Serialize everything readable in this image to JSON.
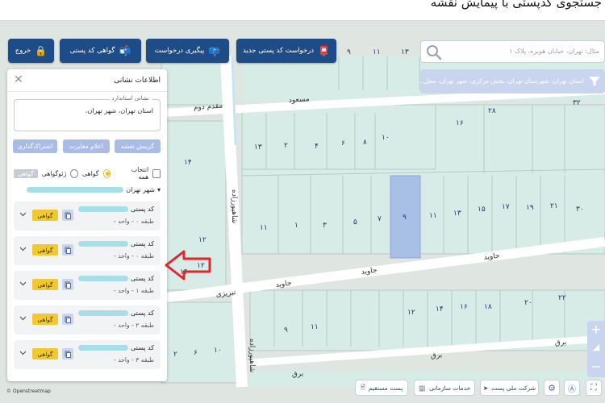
{
  "title": "جستجوی کدپستی با پیمایش نقشه",
  "toolbar": {
    "exit": "خروج",
    "certificate": "گواهی کد پستی",
    "track": "پیگیری درخواست",
    "new_request": "درخواست کد پستی جدید"
  },
  "search": {
    "placeholder": "مثال: تهران، خیابان هویزه، پلاک ۱"
  },
  "filter": {
    "text": "استان تهران، شهرستان تهران، بخش مرکزی، شهر تهران، محل..."
  },
  "panel": {
    "title": "اطلاعات نشانی",
    "address_legend": "نشانی استاندارد",
    "address_value": "استان تهران، شهر تهران،",
    "buttons": {
      "map_pin": "گزینش نقشه",
      "report": "اعلام مغایرت",
      "share": "اشتراک‌گذاری"
    },
    "select_all": "انتخاب همه",
    "option_certificate": "گواهی",
    "option_geo_certificate": "ژئوگواهی",
    "tag_certificate": "گواهی",
    "city": "شهر تهران",
    "cards": [
      {
        "label": "کد پستی",
        "detail": "طبقه ۰ - واحد -",
        "badge": "گواهی"
      },
      {
        "label": "کد پستی",
        "detail": "طبقه ۰ - واحد -",
        "badge": "گواهی"
      },
      {
        "label": "کد پستی",
        "detail": "طبقه ۱ - واحد -",
        "badge": "گواهی"
      },
      {
        "label": "کد پستی",
        "detail": "طبقه ۲ - واحد -",
        "badge": "گواهی"
      },
      {
        "label": "کد پستی",
        "detail": "طبقه ۳ - واحد -",
        "badge": "گواهی"
      }
    ]
  },
  "bottom": {
    "osm": "© Openstreetmap",
    "post_direct": "پست مستقیم",
    "org_services": "خدمات سازمانی",
    "national_post": "شرکت ملی پست"
  },
  "map": {
    "streets": [
      "مسعود",
      "مقدم دوم",
      "مسعود",
      "شاهپورزاده",
      "جاوید",
      "جاوید",
      "تبریزی",
      "شاهپورزاده",
      "برق",
      "برق"
    ],
    "parcel_numbers": [
      "۹",
      "۱۱",
      "۱۳",
      "۲",
      "۴",
      "۶",
      "۸",
      "۱۰",
      "۱۳",
      "۱۶",
      "۲۸",
      "۳۲",
      "۱۴",
      "۱۱",
      "۱",
      "۳",
      "۵",
      "۷",
      "۹",
      "۱۱",
      "۱۳",
      "۱۵",
      "۱۷",
      "۱۹",
      "۲۱",
      "۳۰",
      "۱۲",
      "۱۴",
      "۱۲",
      "۸",
      "۱۰",
      "۱۲",
      "۱۴",
      "۱۶",
      "۱۸",
      "۲۰",
      "۲۲",
      "۹",
      "۱۱",
      "۲",
      "۴",
      "۶",
      "۸",
      "۱۰",
      "۱۲",
      "۱۴"
    ]
  },
  "colors": {
    "primary": "#1d4c86",
    "accent": "#f2c830",
    "light": "#c9d4ef",
    "parcel": "#d8ece7",
    "highlight": "#a8bfe6"
  }
}
